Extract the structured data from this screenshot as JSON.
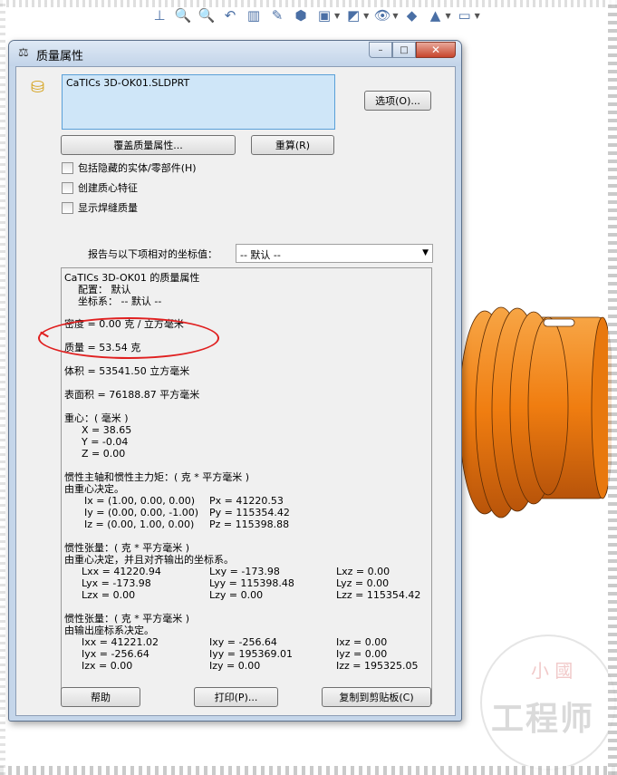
{
  "dialog": {
    "title": "质量属性",
    "selected_file": "CaTICs 3D-OK01.SLDPRT",
    "options_button": "选项(O)...",
    "override_button": "覆盖质量属性...",
    "recalc_button": "重算(R)",
    "checkboxes": [
      {
        "label": "包括隐藏的实体/零部件(H)",
        "checked": false
      },
      {
        "label": "创建质心特征",
        "checked": false
      },
      {
        "label": "显示焊缝质量",
        "checked": false
      }
    ],
    "coord_label": "报告与以下项相对的坐标值：",
    "coord_value": "-- 默认 --",
    "help_button": "帮助",
    "print_button": "打印(P)...",
    "copy_button": "复制到剪贴板(C)",
    "window_buttons": {
      "minimize": "–",
      "maximize": "□",
      "close": "✕"
    }
  },
  "results": {
    "heading": "CaTICs 3D-OK01 的质量属性",
    "config": "配置：  默认",
    "coord_sys": "坐标系：  -- 默认 --",
    "density": "密度 = 0.00 克 / 立方毫米",
    "mass": "质量 = 53.54 克",
    "volume": "体积 = 53541.50 立方毫米",
    "surface_area": "表面积 = 76188.87  平方毫米",
    "com_title": "重心：( 毫米 )",
    "com_x": "X = 38.65",
    "com_y": "Y = -0.04",
    "com_z": "Z = 0.00",
    "principal_title": "惯性主轴和惯性主力矩：( 克 *  平方毫米 )",
    "principal_sub": "由重心决定。",
    "ix": "Ix = (1.00,  0.00,  0.00)",
    "iy": "Iy = (0.00,  0.00, -1.00)",
    "iz": "Iz = (0.00,  1.00,  0.00)",
    "px": "Px = 41220.53",
    "py": "Py = 115354.42",
    "pz": "Pz = 115398.88",
    "tensor1_title": "惯性张量：( 克 *  平方毫米 )",
    "tensor1_sub": "由重心决定，并且对齐输出的坐标系。",
    "lxx": "Lxx = 41220.94",
    "lxy": "Lxy = -173.98",
    "lxz": "Lxz = 0.00",
    "lyx": "Lyx = -173.98",
    "lyy": "Lyy = 115398.48",
    "lyz": "Lyz = 0.00",
    "lzx": "Lzx = 0.00",
    "lzy": "Lzy = 0.00",
    "lzz": "Lzz = 115354.42",
    "tensor2_title": "惯性张量：( 克 *  平方毫米 )",
    "tensor2_sub": "由输出座标系决定。",
    "ixx": "Ixx = 41221.02",
    "ixy": "Ixy = -256.64",
    "ixz": "Ixz = 0.00",
    "iyx": "Iyx = -256.64",
    "iyy": "Iyy = 195369.01",
    "iyz": "Iyz = 0.00",
    "izx": "Izx = 0.00",
    "izy": "Izy = 0.00",
    "izz": "Izz = 195325.05"
  },
  "watermark": {
    "top": "小 國",
    "main": "工程师"
  },
  "colors": {
    "model_orange": "#f07d10",
    "annotation_red": "#e02020"
  }
}
